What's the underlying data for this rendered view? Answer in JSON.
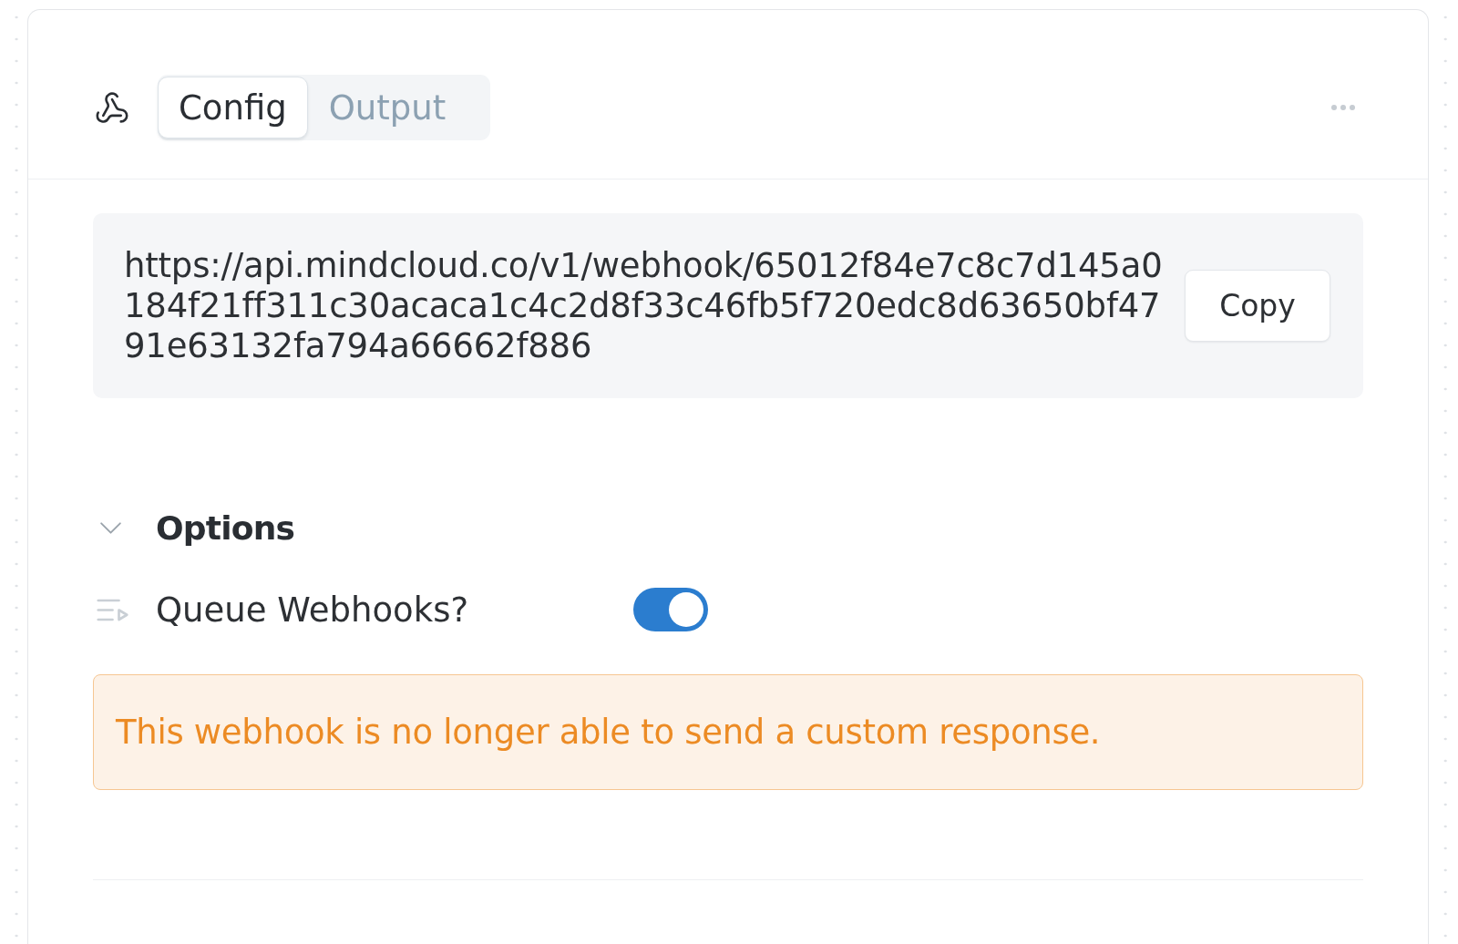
{
  "header": {
    "tabs": [
      {
        "label": "Config",
        "selected": true
      },
      {
        "label": "Output",
        "selected": false
      }
    ]
  },
  "webhook": {
    "url": "https://api.mindcloud.co/v1/webhook/65012f84e7c8c7d145a0184f21ff311c30acaca1c4c2d8f33c46fb5f720edc8d63650bf4791e63132fa794a66662f886",
    "copy_button": "Copy"
  },
  "options": {
    "title": "Options",
    "expanded": true,
    "items": [
      {
        "kind": "toggle",
        "label": "Queue Webhooks?",
        "on": true
      }
    ]
  },
  "warning": {
    "text": "This webhook is no longer able to send a custom response."
  }
}
